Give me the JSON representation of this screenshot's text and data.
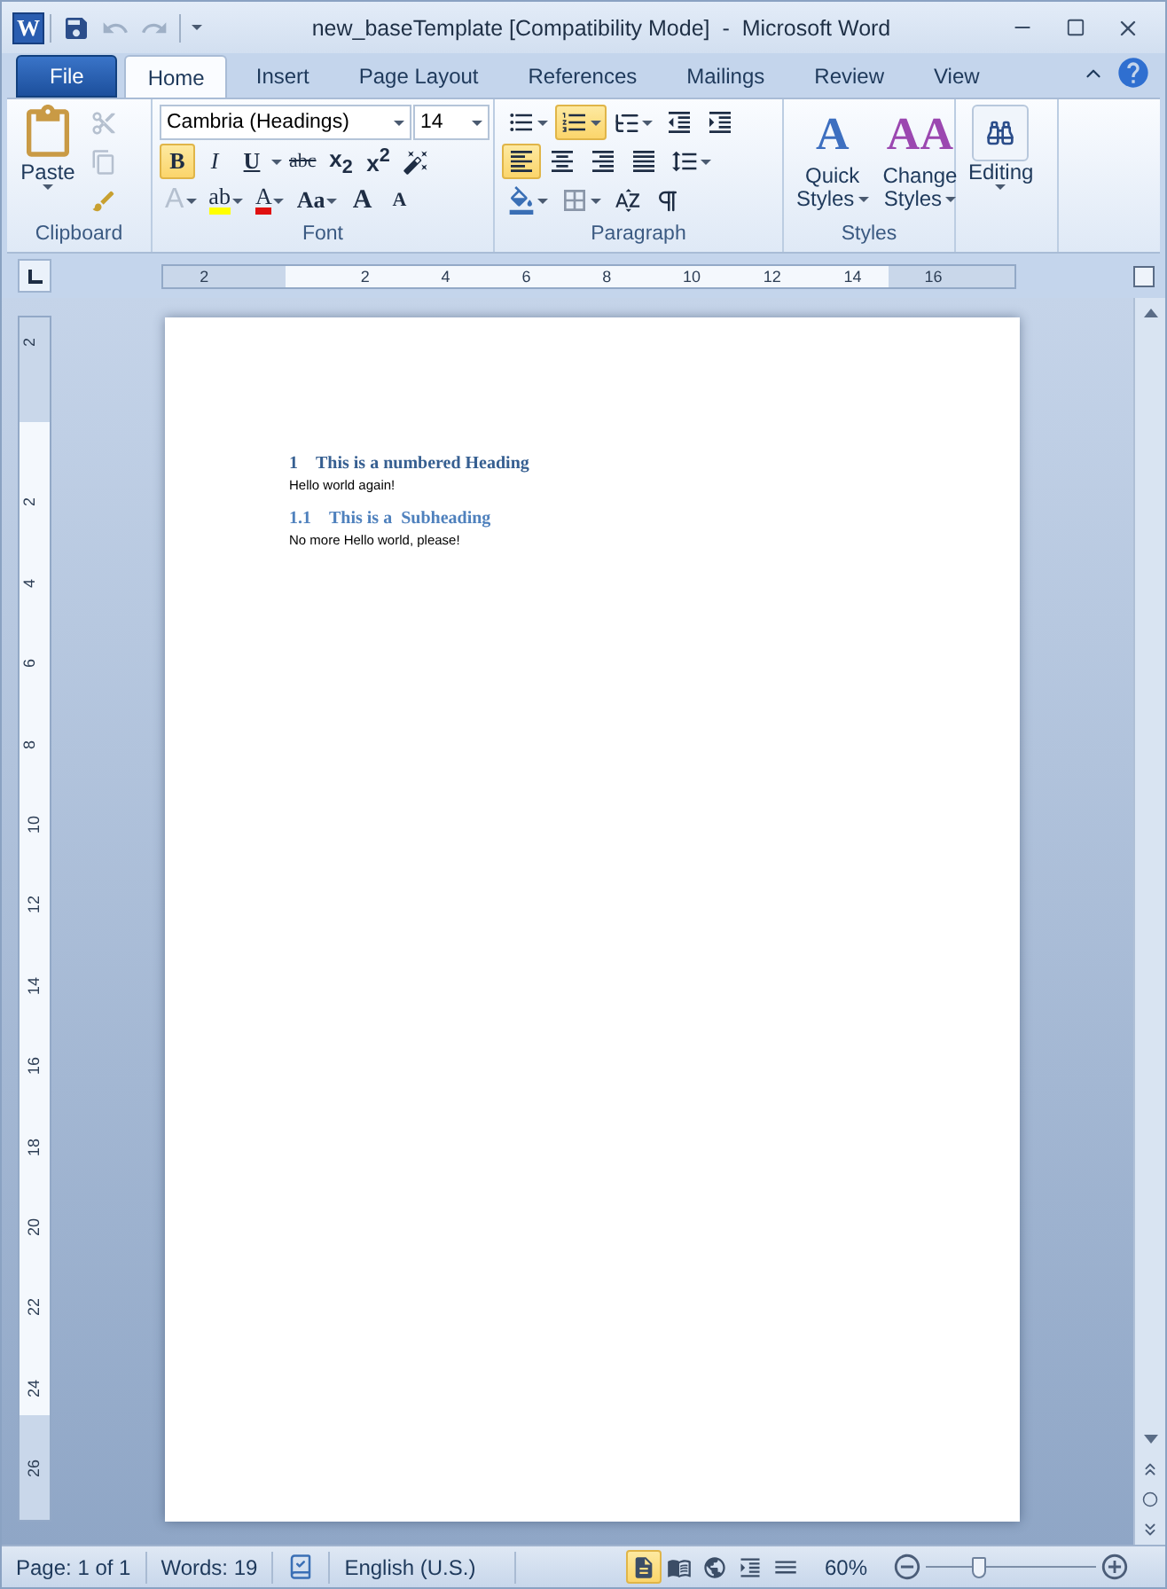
{
  "window": {
    "title": "new_baseTemplate [Compatibility Mode]  -  Microsoft Word",
    "app_icon": "W"
  },
  "quick_access": [
    {
      "kind": "save",
      "disabled": false
    },
    {
      "kind": "undo",
      "disabled": true
    },
    {
      "kind": "redo",
      "disabled": true
    }
  ],
  "tabs": [
    {
      "label": "File",
      "kind": "file",
      "selected": false
    },
    {
      "label": "Home",
      "kind": "tab",
      "selected": true
    },
    {
      "label": "Insert",
      "kind": "tab",
      "selected": false
    },
    {
      "label": "Page Layout",
      "kind": "tab",
      "selected": false
    },
    {
      "label": "References",
      "kind": "tab",
      "selected": false
    },
    {
      "label": "Mailings",
      "kind": "tab",
      "selected": false
    },
    {
      "label": "Review",
      "kind": "tab",
      "selected": false
    },
    {
      "label": "View",
      "kind": "tab",
      "selected": false
    }
  ],
  "ribbon": {
    "clipboard": {
      "label": "Clipboard",
      "paste": "Paste"
    },
    "font": {
      "label": "Font",
      "font_name": "Cambria (Headings)",
      "font_size": "14",
      "row1": [
        {
          "label": "B",
          "kind": "bold",
          "selected": true
        },
        {
          "label": "I",
          "kind": "italic",
          "selected": false
        },
        {
          "label": "U",
          "kind": "underline",
          "selected": false
        },
        {
          "label": "abc",
          "kind": "strike",
          "selected": false
        },
        {
          "label": "x$_{2}$",
          "kind": "sub",
          "selected": false
        },
        {
          "label": "x$^{2}$",
          "kind": "sup",
          "selected": false
        }
      ],
      "row2": [
        {
          "label": "A",
          "kind": "effects",
          "disabled": true
        },
        {
          "label": "ab",
          "kind": "highlight",
          "disabled": false
        },
        {
          "label": "A",
          "kind": "color",
          "disabled": false
        },
        {
          "label": "Aa",
          "kind": "case",
          "disabled": false
        },
        {
          "label": "A",
          "kind": "grow",
          "disabled": false
        },
        {
          "label": "A",
          "kind": "shrink",
          "disabled": false
        }
      ]
    },
    "paragraph": {
      "label": "Paragraph",
      "lists": [
        {
          "kind": "bullets",
          "selected": false
        },
        {
          "kind": "numbering",
          "selected": true
        },
        {
          "kind": "multilevel",
          "selected": false
        }
      ],
      "align": [
        {
          "kind": "left",
          "selected": true
        },
        {
          "kind": "center",
          "selected": false
        },
        {
          "kind": "right",
          "selected": false
        },
        {
          "kind": "justify",
          "selected": false
        }
      ]
    },
    "styles": {
      "label": "Styles",
      "buttons": [
        {
          "kind": "quick",
          "glyph": "A",
          "line1": "Quick",
          "line2": "Styles"
        },
        {
          "kind": "change",
          "glyph": "AA",
          "line1": "Change",
          "line2": "Styles"
        }
      ]
    },
    "editing": {
      "label": "Editing"
    }
  },
  "ruler": {
    "labels": [
      "2",
      "2",
      "4",
      "6",
      "8",
      "10",
      "12",
      "14",
      "16"
    ]
  },
  "vertical_ruler": {
    "labels": [
      "2",
      "2",
      "4",
      "6",
      "8",
      "10",
      "12",
      "14",
      "16",
      "18",
      "20",
      "22",
      "24",
      "26"
    ]
  },
  "document": {
    "blocks": [
      {
        "kind": "heading",
        "number": "1",
        "text": "This is a numbered Heading"
      },
      {
        "kind": "body",
        "text": "Hello world again!"
      },
      {
        "kind": "subheading",
        "number": "1.1",
        "text": "This is a  Subheading"
      },
      {
        "kind": "body",
        "text": "No more Hello world, please!"
      }
    ]
  },
  "status_bar": {
    "page": "Page: 1 of 1",
    "words": "Words: 19",
    "language": "English (U.S.)",
    "views": [
      {
        "kind": "print",
        "selected": true
      },
      {
        "kind": "reading",
        "selected": false
      },
      {
        "kind": "web",
        "selected": false
      },
      {
        "kind": "outline",
        "selected": false
      },
      {
        "kind": "draft",
        "selected": false
      }
    ],
    "zoom": "60%",
    "zoom_slider": {
      "level": 0.29
    }
  }
}
